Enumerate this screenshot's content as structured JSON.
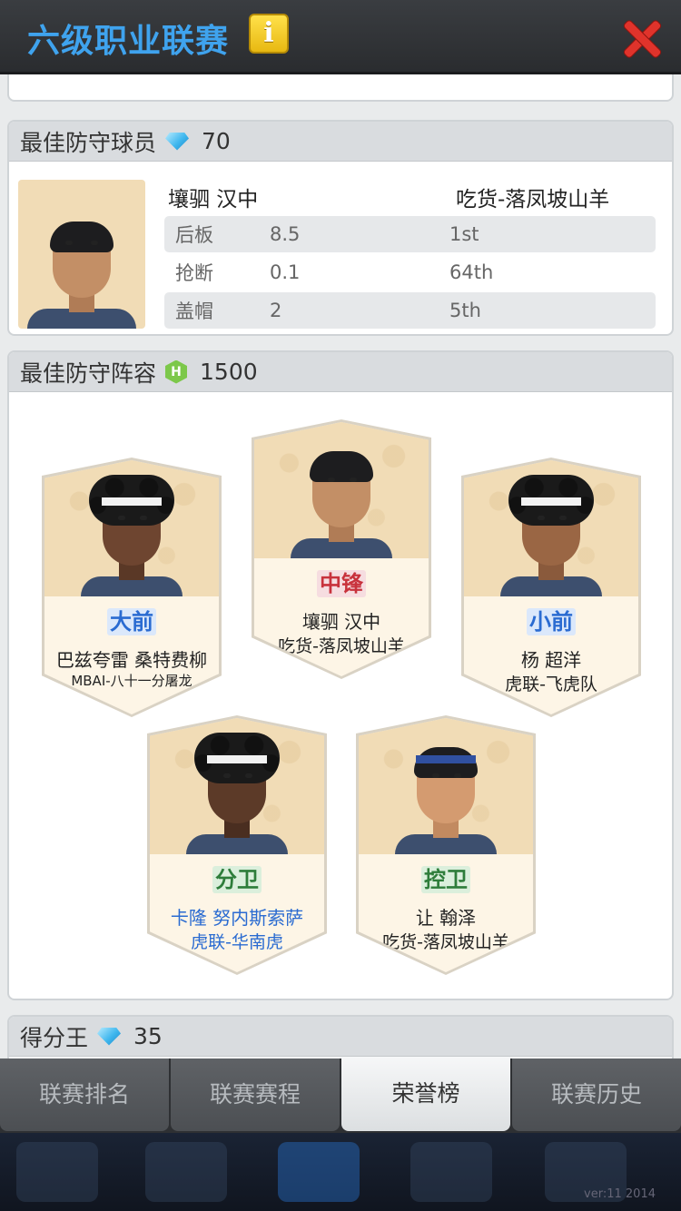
{
  "header": {
    "title": "六级职业联赛",
    "info_icon": "i"
  },
  "dpoy": {
    "title": "最佳防守球员",
    "icon": "diamond-gem-icon",
    "value": "70",
    "player_name": "壤驷 汉中",
    "team": "吃货-落凤坡山羊",
    "stats": [
      {
        "label": "后板",
        "value": "8.5",
        "rank": "1st"
      },
      {
        "label": "抢断",
        "value": "0.1",
        "rank": "64th"
      },
      {
        "label": "盖帽",
        "value": "2",
        "rank": "5th"
      }
    ]
  },
  "lineup": {
    "title": "最佳防守阵容",
    "icon": "hexagon-h-icon",
    "value": "1500",
    "cards": [
      {
        "position": "大前",
        "name": "巴兹夸雷 桑特费柳",
        "team": "MBAI-八十一分屠龙"
      },
      {
        "position": "中锋",
        "name": "壤驷 汉中",
        "team": "吃货-落凤坡山羊"
      },
      {
        "position": "小前",
        "name": "杨 超洋",
        "team": "虎联-飞虎队"
      },
      {
        "position": "分卫",
        "name": "卡隆 努内斯索萨",
        "team": "虎联-华南虎"
      },
      {
        "position": "控卫",
        "name": "让 翰泽",
        "team": "吃货-落凤坡山羊"
      }
    ]
  },
  "scoring": {
    "title": "得分王",
    "icon": "diamond-gem-icon",
    "value": "35"
  },
  "tabs": [
    "联赛排名",
    "联赛赛程",
    "荣誉榜",
    "联赛历史"
  ],
  "active_tab": "荣誉榜",
  "version": "ver:11  2014",
  "colors": {
    "title_blue": "#3fa3ee",
    "position_blue": "#2a6bd1",
    "position_red": "#c8323c",
    "position_green": "#2e7d3a",
    "close_red": "#e0332b"
  }
}
